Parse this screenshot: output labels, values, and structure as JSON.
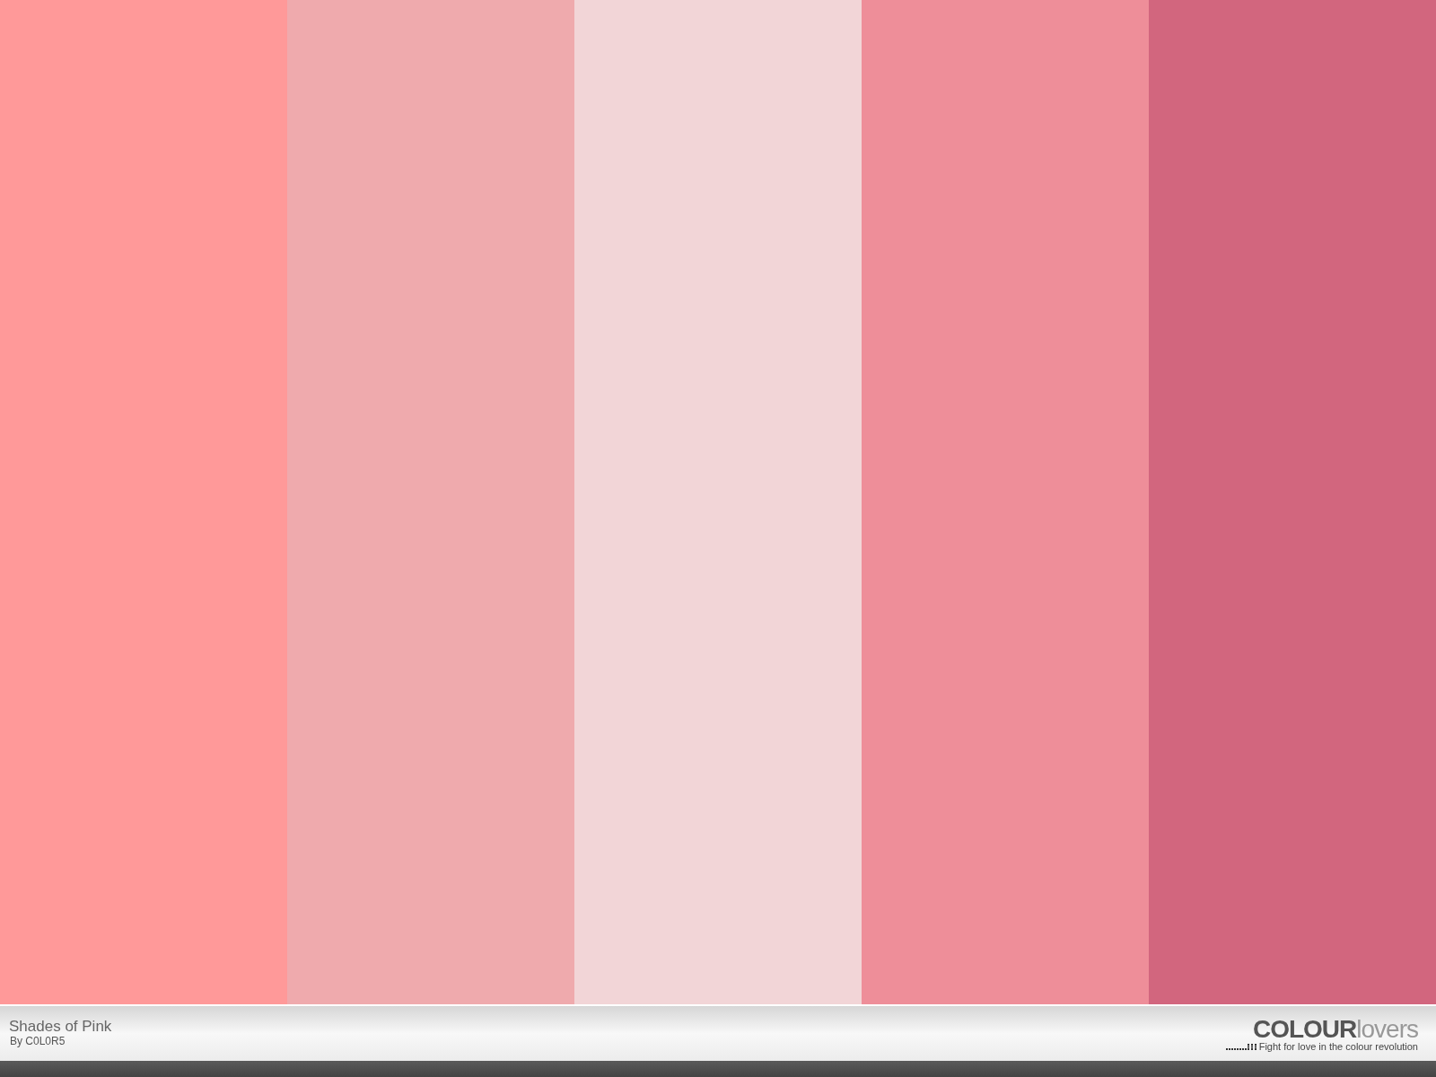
{
  "swatches": [
    {
      "color": "#ff9999"
    },
    {
      "color": "#efaaad"
    },
    {
      "color": "#f2d5d7"
    },
    {
      "color": "#ee8e99"
    },
    {
      "color": "#d2667e"
    }
  ],
  "footer": {
    "title": "Shades of Pink",
    "author": "By C0L0R5",
    "logo": {
      "strong": "COLOUR",
      "light": "lovers"
    },
    "tagline": "Fight for love in the colour revolution"
  }
}
